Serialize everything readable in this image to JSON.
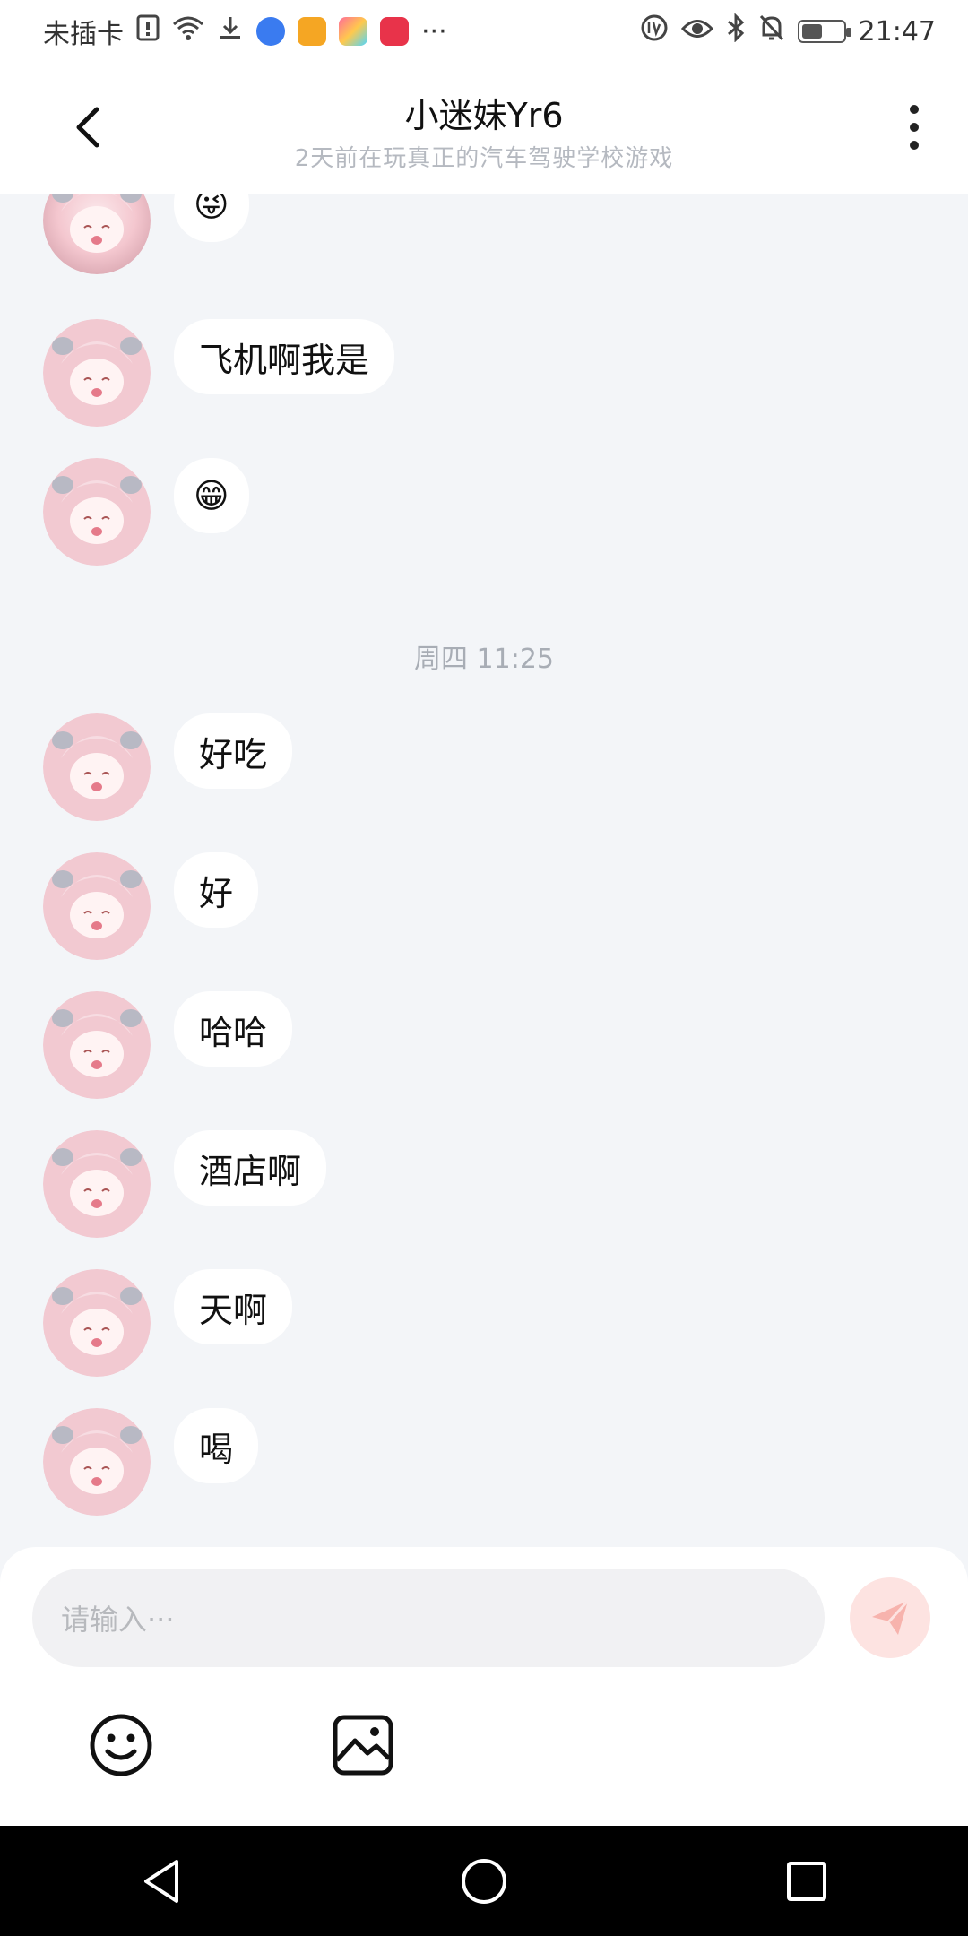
{
  "status_bar": {
    "carrier": "未插卡",
    "time": "21:47",
    "overflow": "···",
    "icons": [
      "sim-alert-icon",
      "wifi-icon",
      "download-icon",
      "music-app-icon",
      "orange-app-icon",
      "colorful-app-icon",
      "huawei-app-icon",
      "volte-icon",
      "eye-icon",
      "bluetooth-icon",
      "mute-icon",
      "battery-icon"
    ]
  },
  "header": {
    "title": "小迷妹Yr6",
    "subtitle": "2天前在玩真正的汽车驾驶学校游戏"
  },
  "messages_before": [
    {
      "text": "😜"
    },
    {
      "text": "飞机啊我是"
    },
    {
      "text": "😁"
    }
  ],
  "timestamp": "周四 11:25",
  "messages_after": [
    {
      "text": "好吃"
    },
    {
      "text": "好"
    },
    {
      "text": "哈哈"
    },
    {
      "text": "酒店啊"
    },
    {
      "text": "天啊"
    },
    {
      "text": "喝"
    }
  ],
  "input": {
    "placeholder": "请输入···"
  },
  "colors": {
    "background": "#f3f5f8",
    "bubble": "#ffffff",
    "send_button": "#fde3e1",
    "send_icon": "#f7b3ad"
  }
}
